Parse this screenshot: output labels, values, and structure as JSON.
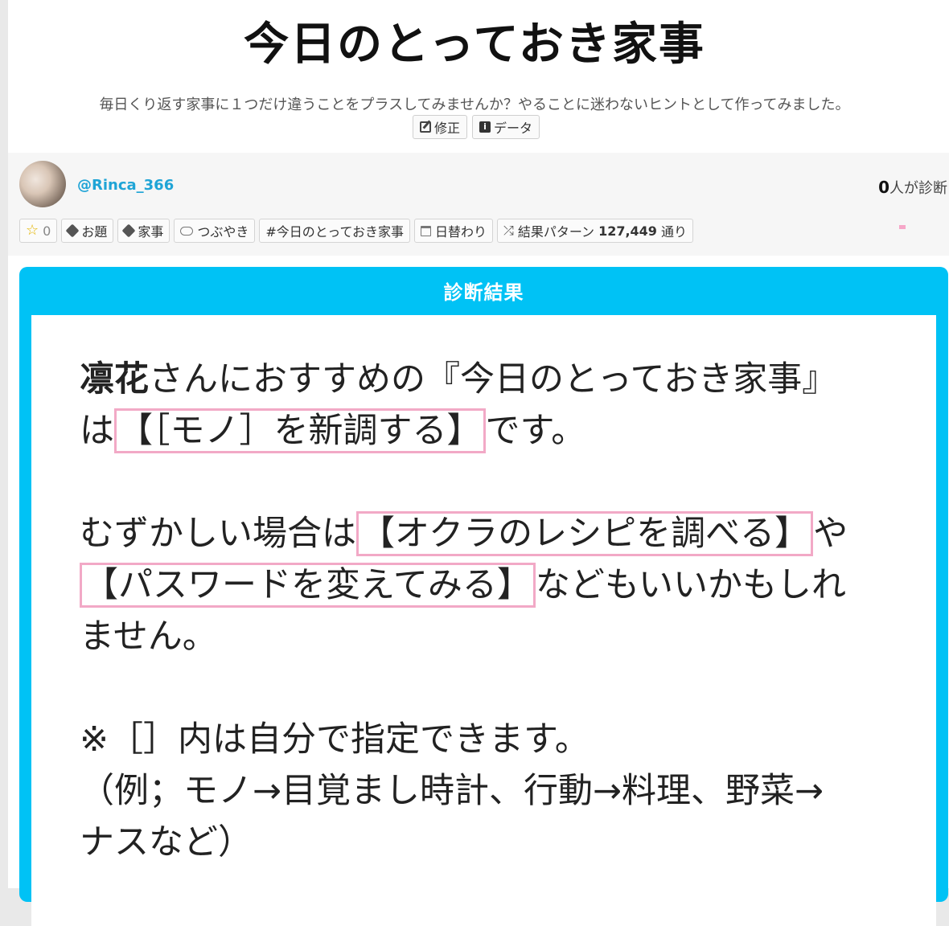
{
  "header": {
    "title": "今日のとっておき家事",
    "description": "毎日くり返す家事に１つだけ違うことをプラスしてみませんか？やることに迷わないヒントとして作ってみました。",
    "edit_label": "修正",
    "data_label": "データ"
  },
  "author": {
    "handle": "@Rinca_366",
    "count": "0",
    "count_suffix": "人が診断"
  },
  "tags": {
    "star_count": "0",
    "odai": "お題",
    "kaji": "家事",
    "tsubuyaki": "つぶやき",
    "hashtag": "#今日のとっておき家事",
    "daily": "日替わり",
    "pattern_prefix": "結果パターン",
    "pattern_count": "127,449",
    "pattern_suffix": "通り"
  },
  "result": {
    "header": "診断結果",
    "name": "凛花",
    "line1_rest": "さんにおすすめの『今日のとっておき家事』",
    "line2_pre": "は",
    "main_item": "【［モノ］を新調する】",
    "line2_post": "です。",
    "alt_pre": "むずかしい場合は",
    "alt1": "【オクラのレシピを調べる】",
    "alt_mid": "や",
    "alt2": "【パスワードを変えてみる】",
    "alt_post": "などもいいかもしれ",
    "alt_post2": "ません。",
    "note1": "※［］内は自分で指定できます。",
    "note2": "（例；モノ→目覚まし時計、行動→料理、野菜→",
    "note3": "ナスなど）"
  },
  "colors": {
    "accent": "#00c2f5",
    "highlight_border": "#f2a9c6",
    "link": "#1fa4d6"
  }
}
